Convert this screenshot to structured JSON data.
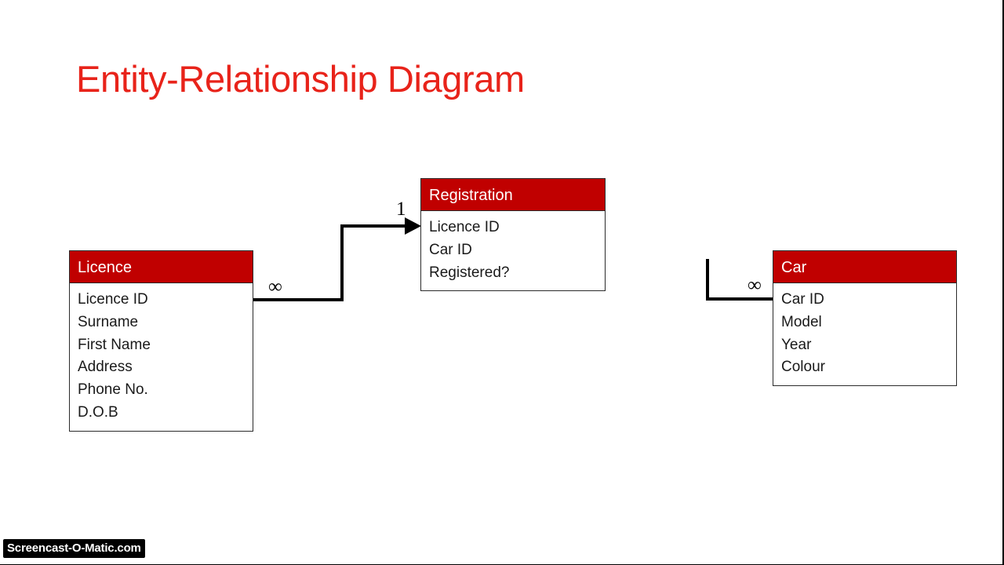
{
  "slide": {
    "title": "Entity-Relationship Diagram",
    "title_color": "#E8231A",
    "background_color": "#FFFFFF",
    "header_color": "#C00000",
    "header_text_color": "#FFFFFF",
    "line_color": "#000000"
  },
  "entities": [
    {
      "id": "licence",
      "name": "Licence",
      "attributes": [
        "Licence ID",
        "Surname",
        "First Name",
        "Address",
        "Phone No.",
        "D.O.B"
      ]
    },
    {
      "id": "registration",
      "name": "Registration",
      "attributes": [
        "Licence ID",
        "Car ID",
        "Registered?"
      ]
    },
    {
      "id": "car",
      "name": "Car",
      "attributes": [
        "Car ID",
        "Model",
        "Year",
        "Colour"
      ]
    }
  ],
  "relationships": [
    {
      "id": "licence-registration",
      "from": "Licence",
      "to": "Registration",
      "from_cardinality": "∞",
      "to_cardinality": "1",
      "arrow": "arrow-head-icon"
    },
    {
      "id": "registration-car",
      "from": "Registration",
      "to": "Car",
      "to_cardinality": "∞"
    }
  ],
  "watermark": {
    "text": "Screencast-O-Matic.com"
  }
}
